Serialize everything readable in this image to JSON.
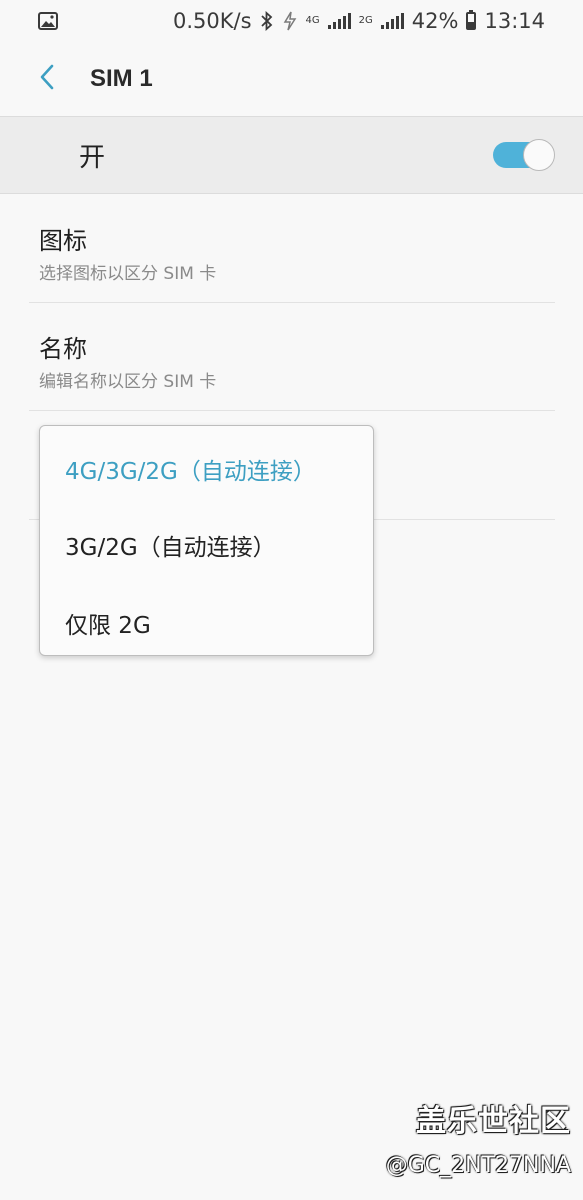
{
  "status_bar": {
    "speed": "0.50K/s",
    "network_4g": "4G",
    "network_2g": "2G",
    "battery": "42%",
    "time": "13:14",
    "icons": [
      "image-icon",
      "bluetooth-icon",
      "flash-icon",
      "signal-icon",
      "battery-icon"
    ]
  },
  "header": {
    "title": "SIM 1"
  },
  "master_switch": {
    "label": "开",
    "state": "on",
    "accent_color": "#4fb2d9"
  },
  "settings": [
    {
      "title": "图标",
      "subtitle": "选择图标以区分 SIM 卡"
    },
    {
      "title": "名称",
      "subtitle": "编辑名称以区分 SIM 卡"
    }
  ],
  "network_mode_menu": {
    "options": [
      {
        "label": "4G/3G/2G（自动连接）",
        "selected": true
      },
      {
        "label": "3G/2G（自动连接）",
        "selected": false
      },
      {
        "label": "仅限 2G",
        "selected": false
      }
    ],
    "selected_color": "#3d9fc2"
  },
  "watermark": {
    "title": "盖乐世社区",
    "handle": "@GC_2NT27NNA"
  }
}
